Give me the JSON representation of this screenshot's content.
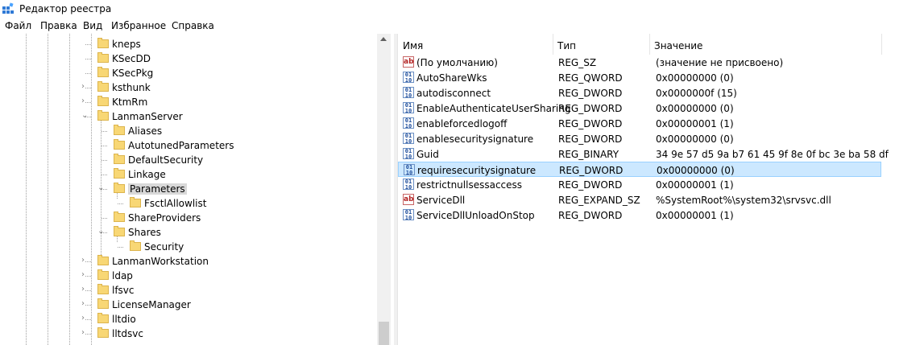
{
  "window": {
    "title": "Редактор реестра"
  },
  "menu": [
    "Файл",
    "Правка",
    "Вид",
    "Избранное",
    "Справка"
  ],
  "tree": [
    {
      "label": "kneps",
      "expander": ""
    },
    {
      "label": "KSecDD",
      "expander": ""
    },
    {
      "label": "KSecPkg",
      "expander": ""
    },
    {
      "label": "ksthunk",
      "expander": ">"
    },
    {
      "label": "KtmRm",
      "expander": ">"
    },
    {
      "label": "LanmanServer",
      "expander": "v"
    },
    {
      "label": "Aliases",
      "expander": ""
    },
    {
      "label": "AutotunedParameters",
      "expander": ""
    },
    {
      "label": "DefaultSecurity",
      "expander": ""
    },
    {
      "label": "Linkage",
      "expander": ""
    },
    {
      "label": "Parameters",
      "expander": "v",
      "selected": true
    },
    {
      "label": "FsctlAllowlist",
      "expander": ""
    },
    {
      "label": "ShareProviders",
      "expander": ""
    },
    {
      "label": "Shares",
      "expander": "v"
    },
    {
      "label": "Security",
      "expander": ""
    },
    {
      "label": "LanmanWorkstation",
      "expander": ">"
    },
    {
      "label": "ldap",
      "expander": ">"
    },
    {
      "label": "lfsvc",
      "expander": ">"
    },
    {
      "label": "LicenseManager",
      "expander": ">"
    },
    {
      "label": "lltdio",
      "expander": ">"
    },
    {
      "label": "lltdsvc",
      "expander": ">"
    }
  ],
  "columns": {
    "name": "Имя",
    "type": "Тип",
    "data": "Значение"
  },
  "values": [
    {
      "name": "(По умолчанию)",
      "type": "REG_SZ",
      "data": "(значение не присвоено)",
      "icon": "string-value-icon"
    },
    {
      "name": "AutoShareWks",
      "type": "REG_QWORD",
      "data": "0x00000000 (0)",
      "icon": "binary-value-icon"
    },
    {
      "name": "autodisconnect",
      "type": "REG_DWORD",
      "data": "0x0000000f (15)",
      "icon": "binary-value-icon"
    },
    {
      "name": "EnableAuthenticateUserSharing",
      "type": "REG_DWORD",
      "data": "0x00000000 (0)",
      "icon": "binary-value-icon"
    },
    {
      "name": "enableforcedlogoff",
      "type": "REG_DWORD",
      "data": "0x00000001 (1)",
      "icon": "binary-value-icon"
    },
    {
      "name": "enablesecuritysignature",
      "type": "REG_DWORD",
      "data": "0x00000000 (0)",
      "icon": "binary-value-icon"
    },
    {
      "name": "Guid",
      "type": "REG_BINARY",
      "data": "34 9e 57 d5 9a b7 61 45 9f 8e 0f bc 3e ba 58 df",
      "icon": "binary-value-icon"
    },
    {
      "name": "requiresecuritysignature",
      "type": "REG_DWORD",
      "data": "0x00000000 (0)",
      "icon": "binary-value-icon",
      "selected": true
    },
    {
      "name": "restrictnullsessaccess",
      "type": "REG_DWORD",
      "data": "0x00000001 (1)",
      "icon": "binary-value-icon"
    },
    {
      "name": "ServiceDll",
      "type": "REG_EXPAND_SZ",
      "data": "%SystemRoot%\\system32\\srvsvc.dll",
      "icon": "string-value-icon"
    },
    {
      "name": "ServiceDllUnloadOnStop",
      "type": "REG_DWORD",
      "data": "0x00000001 (1)",
      "icon": "binary-value-icon"
    }
  ]
}
